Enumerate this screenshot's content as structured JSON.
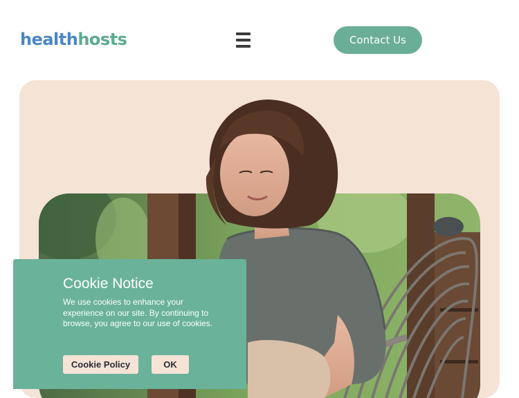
{
  "header": {
    "logo_part1": "health",
    "logo_part2": "hosts",
    "menu_icon": "hamburger-menu-icon",
    "contact_label": "Contact Us"
  },
  "hero": {
    "image_description": "woman-in-wicker-chair-photo"
  },
  "cookie_notice": {
    "title": "Cookie Notice",
    "text": "We use cookies to enhance your experience on our site. By continuing to browse, you agree to our use of cookies.",
    "policy_label": "Cookie Policy",
    "ok_label": "OK"
  },
  "colors": {
    "brand_blue": "#4a87c6",
    "brand_green": "#5dab8f",
    "button_green": "#6aae97",
    "cookie_bg": "#6ab29a",
    "hero_bg": "#f5e3d6"
  }
}
